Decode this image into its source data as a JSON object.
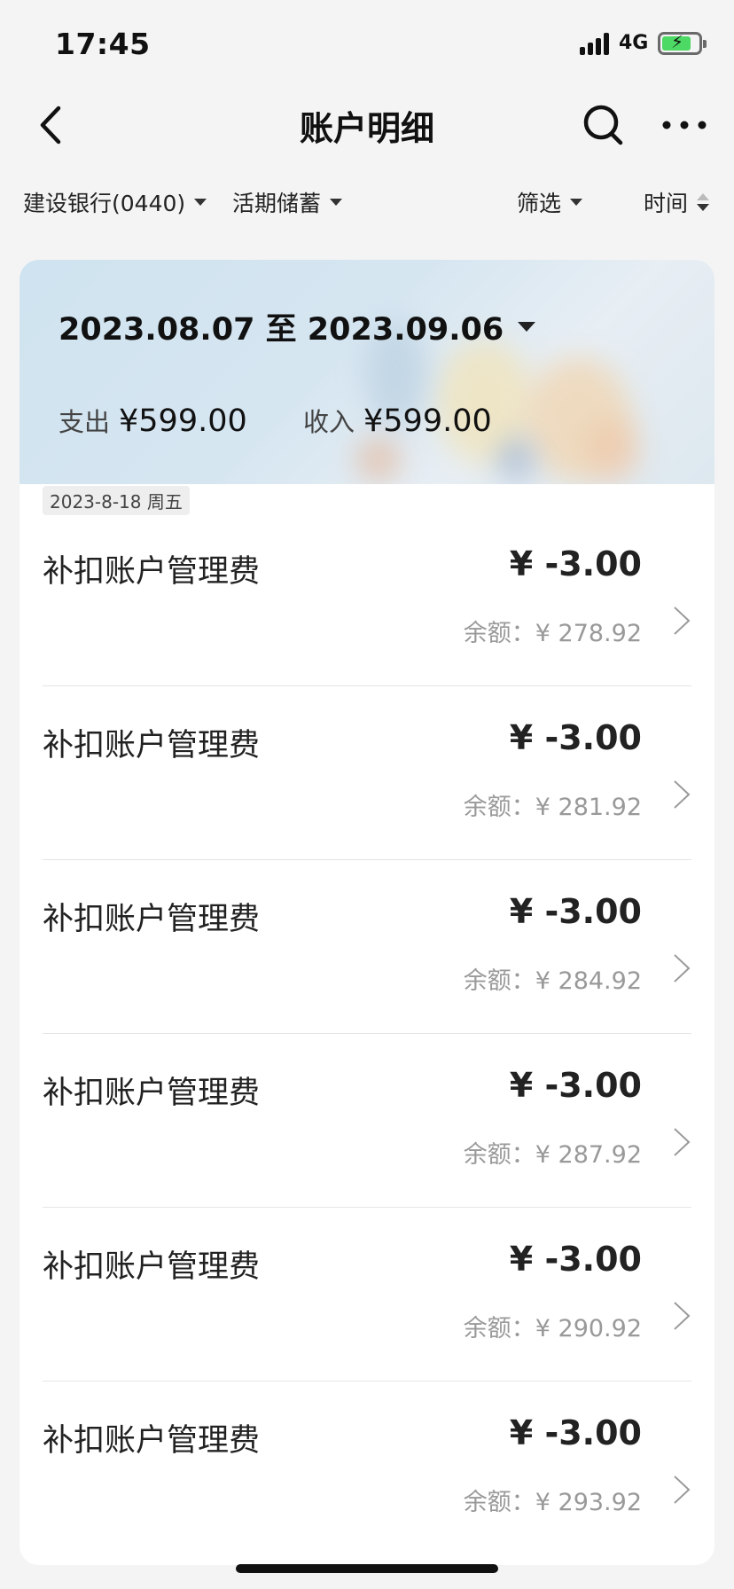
{
  "status_bar": {
    "time": "17:45",
    "network": "4G",
    "icons": [
      "signal-icon",
      "battery-charging-icon"
    ],
    "battery_color": "#4cd964"
  },
  "nav": {
    "title": "账户明细",
    "icons": [
      "back-icon",
      "search-icon",
      "more-icon"
    ]
  },
  "filters": {
    "account": "建设银行(0440)",
    "account_type": "活期储蓄",
    "filter": "筛选",
    "time": "时间"
  },
  "summary": {
    "date_range": "2023.08.07 至 2023.09.06",
    "expense_label": "支出",
    "expense_value": "¥599.00",
    "income_label": "收入",
    "income_value": "¥599.00"
  },
  "date_tag": "2023-8-18 周五",
  "transactions": [
    {
      "name": "补扣账户管理费",
      "amount": "¥ -3.00",
      "balance": "余额：¥ 278.92"
    },
    {
      "name": "补扣账户管理费",
      "amount": "¥ -3.00",
      "balance": "余额：¥ 281.92"
    },
    {
      "name": "补扣账户管理费",
      "amount": "¥ -3.00",
      "balance": "余额：¥ 284.92"
    },
    {
      "name": "补扣账户管理费",
      "amount": "¥ -3.00",
      "balance": "余额：¥ 287.92"
    },
    {
      "name": "补扣账户管理费",
      "amount": "¥ -3.00",
      "balance": "余额：¥ 290.92"
    },
    {
      "name": "补扣账户管理费",
      "amount": "¥ -3.00",
      "balance": "余额：¥ 293.92"
    }
  ]
}
